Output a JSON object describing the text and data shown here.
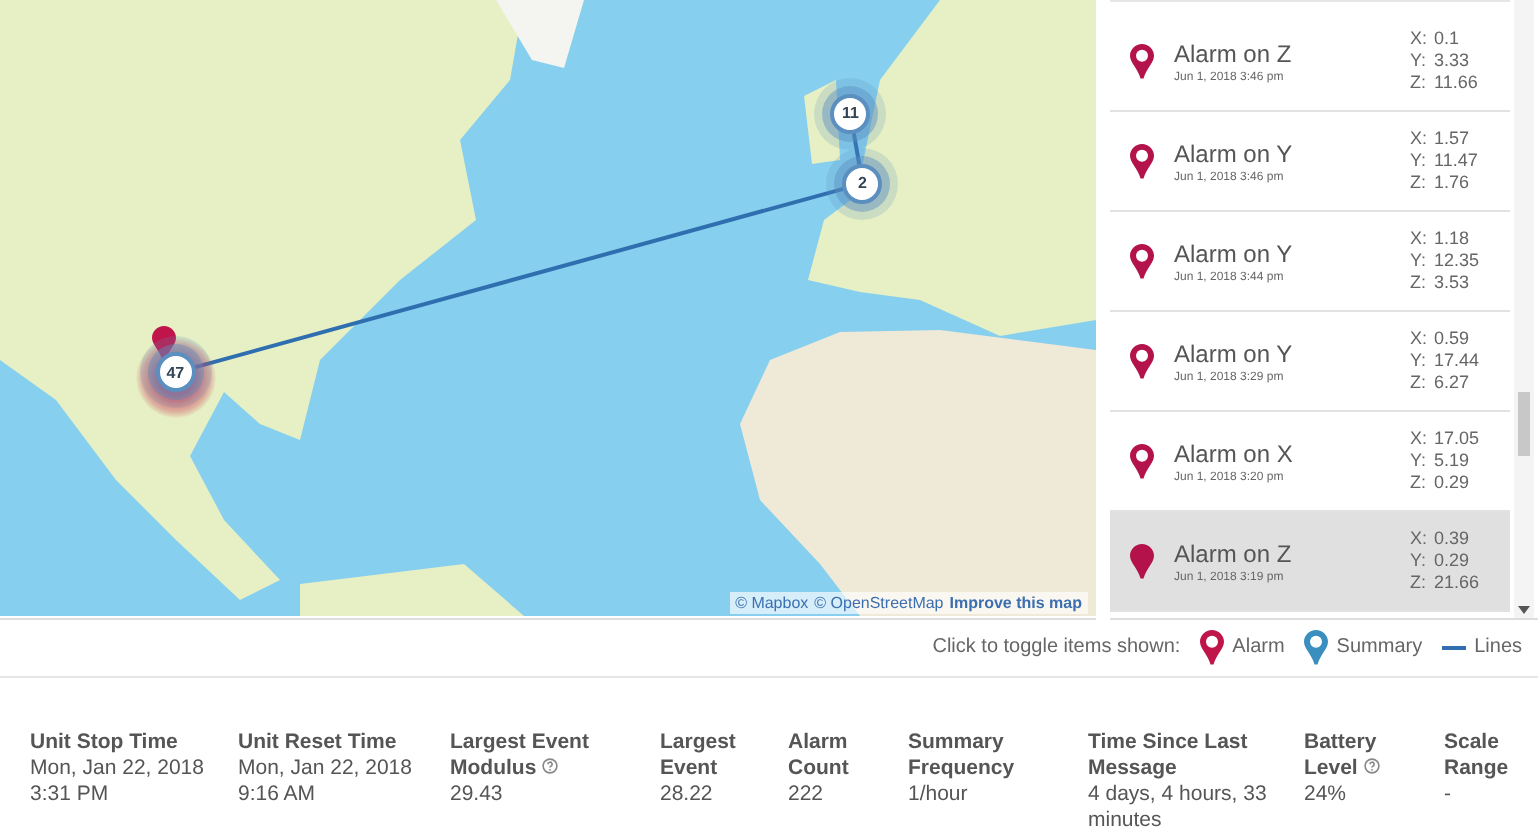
{
  "map": {
    "clusters": [
      {
        "count": "11",
        "kind": "summary"
      },
      {
        "count": "2",
        "kind": "summary"
      },
      {
        "count": "47",
        "kind": "summary"
      }
    ],
    "attribution": [
      "© Mapbox",
      "© OpenStreetMap"
    ],
    "improve_link": "Improve this map"
  },
  "events": [
    {
      "title": "Alarm on Z",
      "time": "Jun 1, 2018 3:46 pm",
      "readings": [
        {
          "axis": "X:",
          "value": "0.1"
        },
        {
          "axis": "Y:",
          "value": "3.33"
        },
        {
          "axis": "Z:",
          "value": "11.66"
        }
      ],
      "selected": false
    },
    {
      "title": "Alarm on Y",
      "time": "Jun 1, 2018 3:46 pm",
      "readings": [
        {
          "axis": "X:",
          "value": "1.57"
        },
        {
          "axis": "Y:",
          "value": "11.47"
        },
        {
          "axis": "Z:",
          "value": "1.76"
        }
      ],
      "selected": false
    },
    {
      "title": "Alarm on Y",
      "time": "Jun 1, 2018 3:44 pm",
      "readings": [
        {
          "axis": "X:",
          "value": "1.18"
        },
        {
          "axis": "Y:",
          "value": "12.35"
        },
        {
          "axis": "Z:",
          "value": "3.53"
        }
      ],
      "selected": false
    },
    {
      "title": "Alarm on Y",
      "time": "Jun 1, 2018 3:29 pm",
      "readings": [
        {
          "axis": "X:",
          "value": "0.59"
        },
        {
          "axis": "Y:",
          "value": "17.44"
        },
        {
          "axis": "Z:",
          "value": "6.27"
        }
      ],
      "selected": false
    },
    {
      "title": "Alarm on X",
      "time": "Jun 1, 2018 3:20 pm",
      "readings": [
        {
          "axis": "X:",
          "value": "17.05"
        },
        {
          "axis": "Y:",
          "value": "5.19"
        },
        {
          "axis": "Z:",
          "value": "0.29"
        }
      ],
      "selected": false
    },
    {
      "title": "Alarm on Z",
      "time": "Jun 1, 2018 3:19 pm",
      "readings": [
        {
          "axis": "X:",
          "value": "0.39"
        },
        {
          "axis": "Y:",
          "value": "0.29"
        },
        {
          "axis": "Z:",
          "value": "21.66"
        }
      ],
      "selected": true
    }
  ],
  "legend": {
    "label": "Click to toggle items shown:",
    "items": [
      {
        "kind": "alarm",
        "label": "Alarm"
      },
      {
        "kind": "summary",
        "label": "Summary"
      },
      {
        "kind": "lines",
        "label": "Lines"
      }
    ]
  },
  "stats": [
    {
      "label": "Unit Stop Time",
      "value": "Mon, Jan 22, 2018 3:31 PM",
      "help": false
    },
    {
      "label": "Unit Reset Time",
      "value": "Mon, Jan 22, 2018 9:16 AM",
      "help": false
    },
    {
      "label": "Largest Event Modulus",
      "value": "29.43",
      "help": true
    },
    {
      "label": "Largest Event",
      "value": "28.22",
      "help": false
    },
    {
      "label": "Alarm Count",
      "value": "222",
      "help": false
    },
    {
      "label": "Summary Frequency",
      "value": "1/hour",
      "help": false
    },
    {
      "label": "Time Since Last Message",
      "value": "4 days, 4 hours, 33 minutes",
      "help": false
    },
    {
      "label": "Battery Level",
      "value": "24%",
      "help": true
    },
    {
      "label": "Scale Range",
      "value": "-",
      "help": false
    }
  ]
}
